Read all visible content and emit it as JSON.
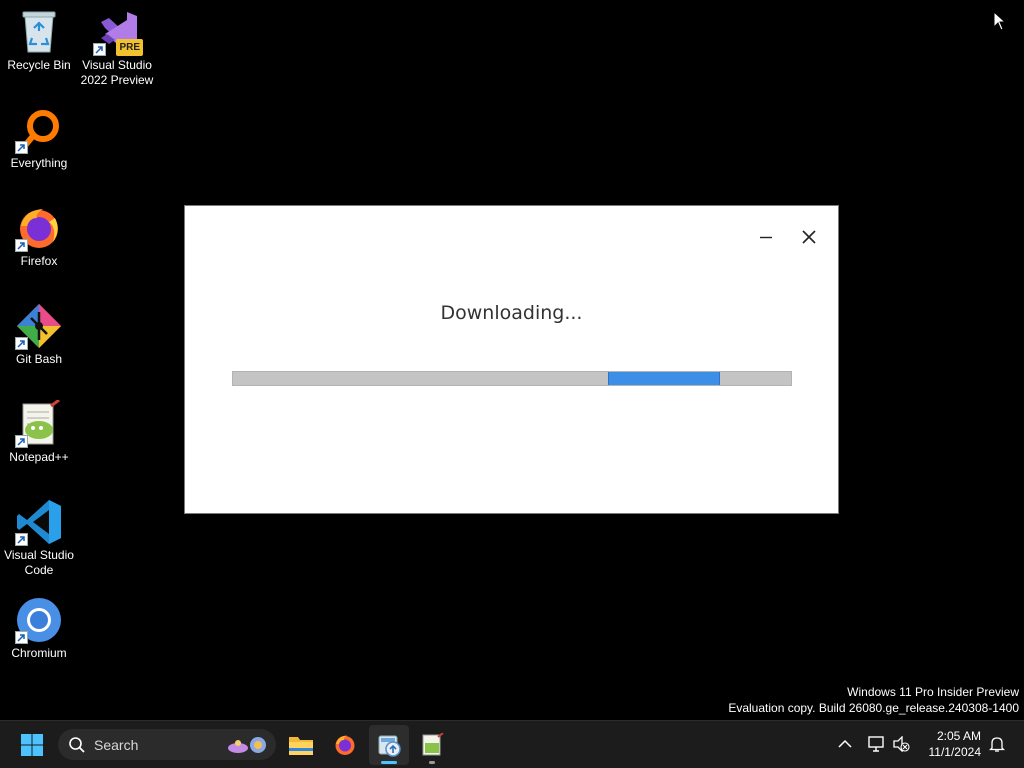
{
  "desktop": {
    "icons": [
      {
        "label": "Recycle Bin",
        "icon": "recycle-bin-icon"
      },
      {
        "label": "Visual Studio 2022 Preview",
        "icon": "visual-studio-preview-icon",
        "badge": "PRE"
      },
      {
        "label": "Everything",
        "icon": "everything-search-icon"
      },
      {
        "label": "Firefox",
        "icon": "firefox-icon"
      },
      {
        "label": "Git Bash",
        "icon": "git-bash-icon"
      },
      {
        "label": "Notepad++",
        "icon": "notepad-plus-plus-icon"
      },
      {
        "label": "Visual Studio Code",
        "icon": "vscode-icon"
      },
      {
        "label": "Chromium",
        "icon": "chromium-icon"
      }
    ]
  },
  "dialog": {
    "status": "Downloading...",
    "minimize_icon": "minimize-icon",
    "close_icon": "close-icon",
    "progress": {
      "style": "indeterminate-marquee",
      "accent": "#3d8ee6",
      "track": "#c4c4c4"
    }
  },
  "watermark": {
    "line1": "Windows 11 Pro Insider Preview",
    "line2": "Evaluation copy. Build 26080.ge_release.240308-1400"
  },
  "taskbar": {
    "search_placeholder": "Search",
    "apps": [
      {
        "name": "start",
        "icon": "windows-start-icon"
      },
      {
        "name": "file-explorer",
        "icon": "folder-icon"
      },
      {
        "name": "firefox",
        "icon": "firefox-icon"
      },
      {
        "name": "installer",
        "icon": "installer-app-icon",
        "active": true
      },
      {
        "name": "notepad-plus-plus",
        "icon": "notepad-plus-plus-icon"
      }
    ],
    "tray": {
      "time": "2:05 AM",
      "date": "11/1/2024",
      "icons": [
        "chevron-up-icon",
        "network-icon",
        "volume-muted-icon",
        "notification-bell-icon"
      ]
    }
  },
  "colors": {
    "desktop_bg": "#000000",
    "taskbar_bg": "#1c1c1c",
    "accent": "#3d8ee6"
  }
}
